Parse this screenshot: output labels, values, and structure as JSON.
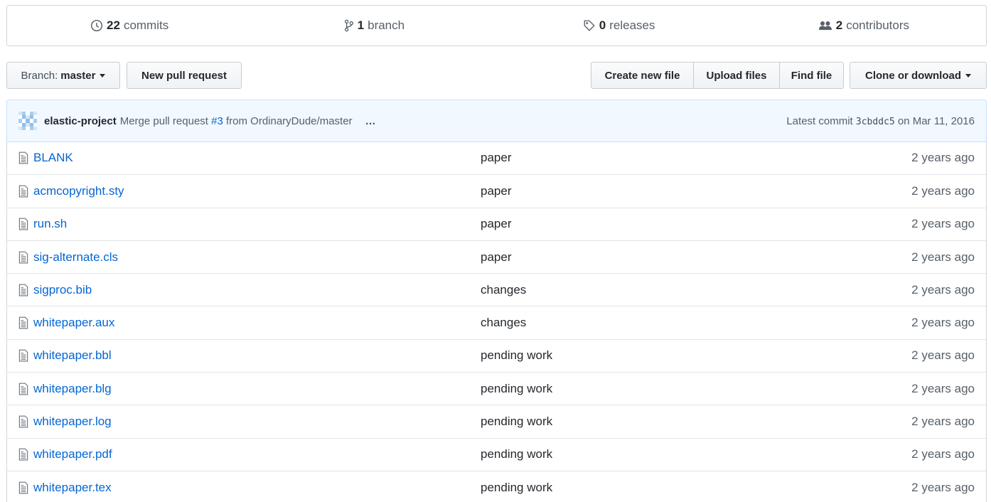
{
  "stats": {
    "commits": {
      "count": "22",
      "label": "commits",
      "icon": "history-icon"
    },
    "branches": {
      "count": "1",
      "label": "branch",
      "icon": "git-branch-icon"
    },
    "releases": {
      "count": "0",
      "label": "releases",
      "icon": "tag-icon"
    },
    "contributors": {
      "count": "2",
      "label": "contributors",
      "icon": "people-icon"
    }
  },
  "toolbar": {
    "branch_prefix": "Branch:",
    "branch_name": "master",
    "new_pull_request": "New pull request",
    "create_new_file": "Create new file",
    "upload_files": "Upload files",
    "find_file": "Find file",
    "clone_or_download": "Clone or download"
  },
  "commit": {
    "author": "elastic-project",
    "message_prefix": "Merge pull request",
    "pr_link": "#3",
    "message_suffix": "from OrdinaryDude/master",
    "ellipsis": "…",
    "latest_label": "Latest commit",
    "sha": "3cbddc5",
    "date": "on Mar 11, 2016"
  },
  "files": [
    {
      "name": "BLANK",
      "message": "paper",
      "age": "2 years ago"
    },
    {
      "name": "acmcopyright.sty",
      "message": "paper",
      "age": "2 years ago"
    },
    {
      "name": "run.sh",
      "message": "paper",
      "age": "2 years ago"
    },
    {
      "name": "sig-alternate.cls",
      "message": "paper",
      "age": "2 years ago"
    },
    {
      "name": "sigproc.bib",
      "message": "changes",
      "age": "2 years ago"
    },
    {
      "name": "whitepaper.aux",
      "message": "changes",
      "age": "2 years ago"
    },
    {
      "name": "whitepaper.bbl",
      "message": "pending work",
      "age": "2 years ago"
    },
    {
      "name": "whitepaper.blg",
      "message": "pending work",
      "age": "2 years ago"
    },
    {
      "name": "whitepaper.log",
      "message": "pending work",
      "age": "2 years ago"
    },
    {
      "name": "whitepaper.pdf",
      "message": "pending work",
      "age": "2 years ago"
    },
    {
      "name": "whitepaper.tex",
      "message": "pending work",
      "age": "2 years ago"
    }
  ],
  "colors": {
    "link": "#0366d6",
    "tease_bg": "#f1f8ff",
    "border": "#d1d5da"
  }
}
